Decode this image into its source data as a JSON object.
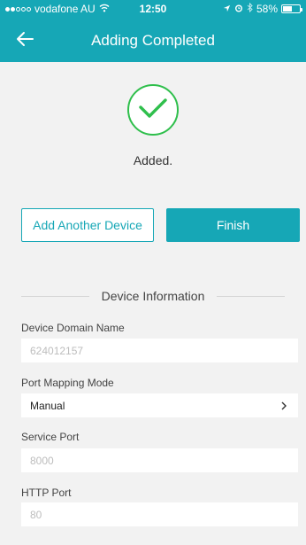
{
  "status_bar": {
    "carrier": "vodafone AU",
    "time": "12:50",
    "battery": "58%",
    "battery_level": 0.58,
    "icons": [
      "signal-icon",
      "wifi-icon",
      "location-icon",
      "alarm-icon",
      "bluetooth-icon",
      "battery-icon"
    ]
  },
  "nav": {
    "title": "Adding Completed",
    "back_icon": "arrow-left-icon"
  },
  "result": {
    "icon": "checkmark-icon",
    "message": "Added."
  },
  "actions": {
    "add_another_label": "Add Another Device",
    "finish_label": "Finish"
  },
  "device_info": {
    "section_title": "Device Information",
    "domain_name_label": "Device Domain Name",
    "domain_name_value": "624012157",
    "port_mapping_label": "Port Mapping Mode",
    "port_mapping_value": "Manual",
    "service_port_label": "Service Port",
    "service_port_value": "8000",
    "http_port_label": "HTTP Port",
    "http_port_value": "80"
  },
  "colors": {
    "accent": "#16a7b6",
    "success": "#2fbf4c",
    "background": "#f2f2f2"
  }
}
